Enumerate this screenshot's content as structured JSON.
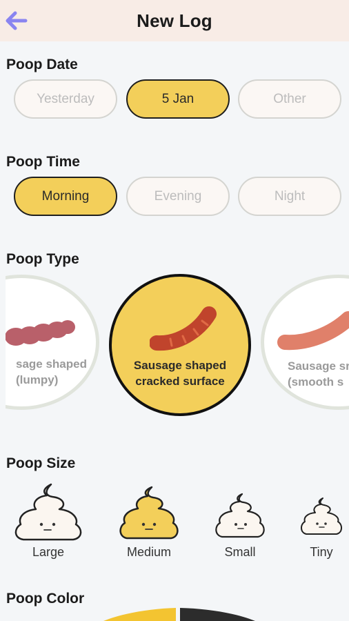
{
  "header": {
    "title": "New Log",
    "back_icon": "arrow-left-icon"
  },
  "date": {
    "title": "Poop Date",
    "options": [
      "Yesterday",
      "5 Jan",
      "Other"
    ],
    "selected": "5 Jan"
  },
  "time": {
    "title": "Poop Time",
    "options": [
      "Morning",
      "Evening",
      "Night"
    ],
    "selected": "Morning"
  },
  "type": {
    "title": "Poop Type",
    "options": [
      {
        "label": "sage shaped\n(lumpy)"
      },
      {
        "label": "Sausage shaped\ncracked surface"
      },
      {
        "label": "Sausage sr\n(smooth s"
      }
    ],
    "selected_index": 1
  },
  "size": {
    "title": "Poop Size",
    "options": [
      "Large",
      "Medium",
      "Small",
      "Tiny"
    ],
    "selected": "Medium"
  },
  "color": {
    "title": "Poop Color"
  },
  "colors": {
    "accent": "#f3cf5a",
    "back_arrow": "#8a84f0",
    "header_bg": "#f8ece6"
  }
}
